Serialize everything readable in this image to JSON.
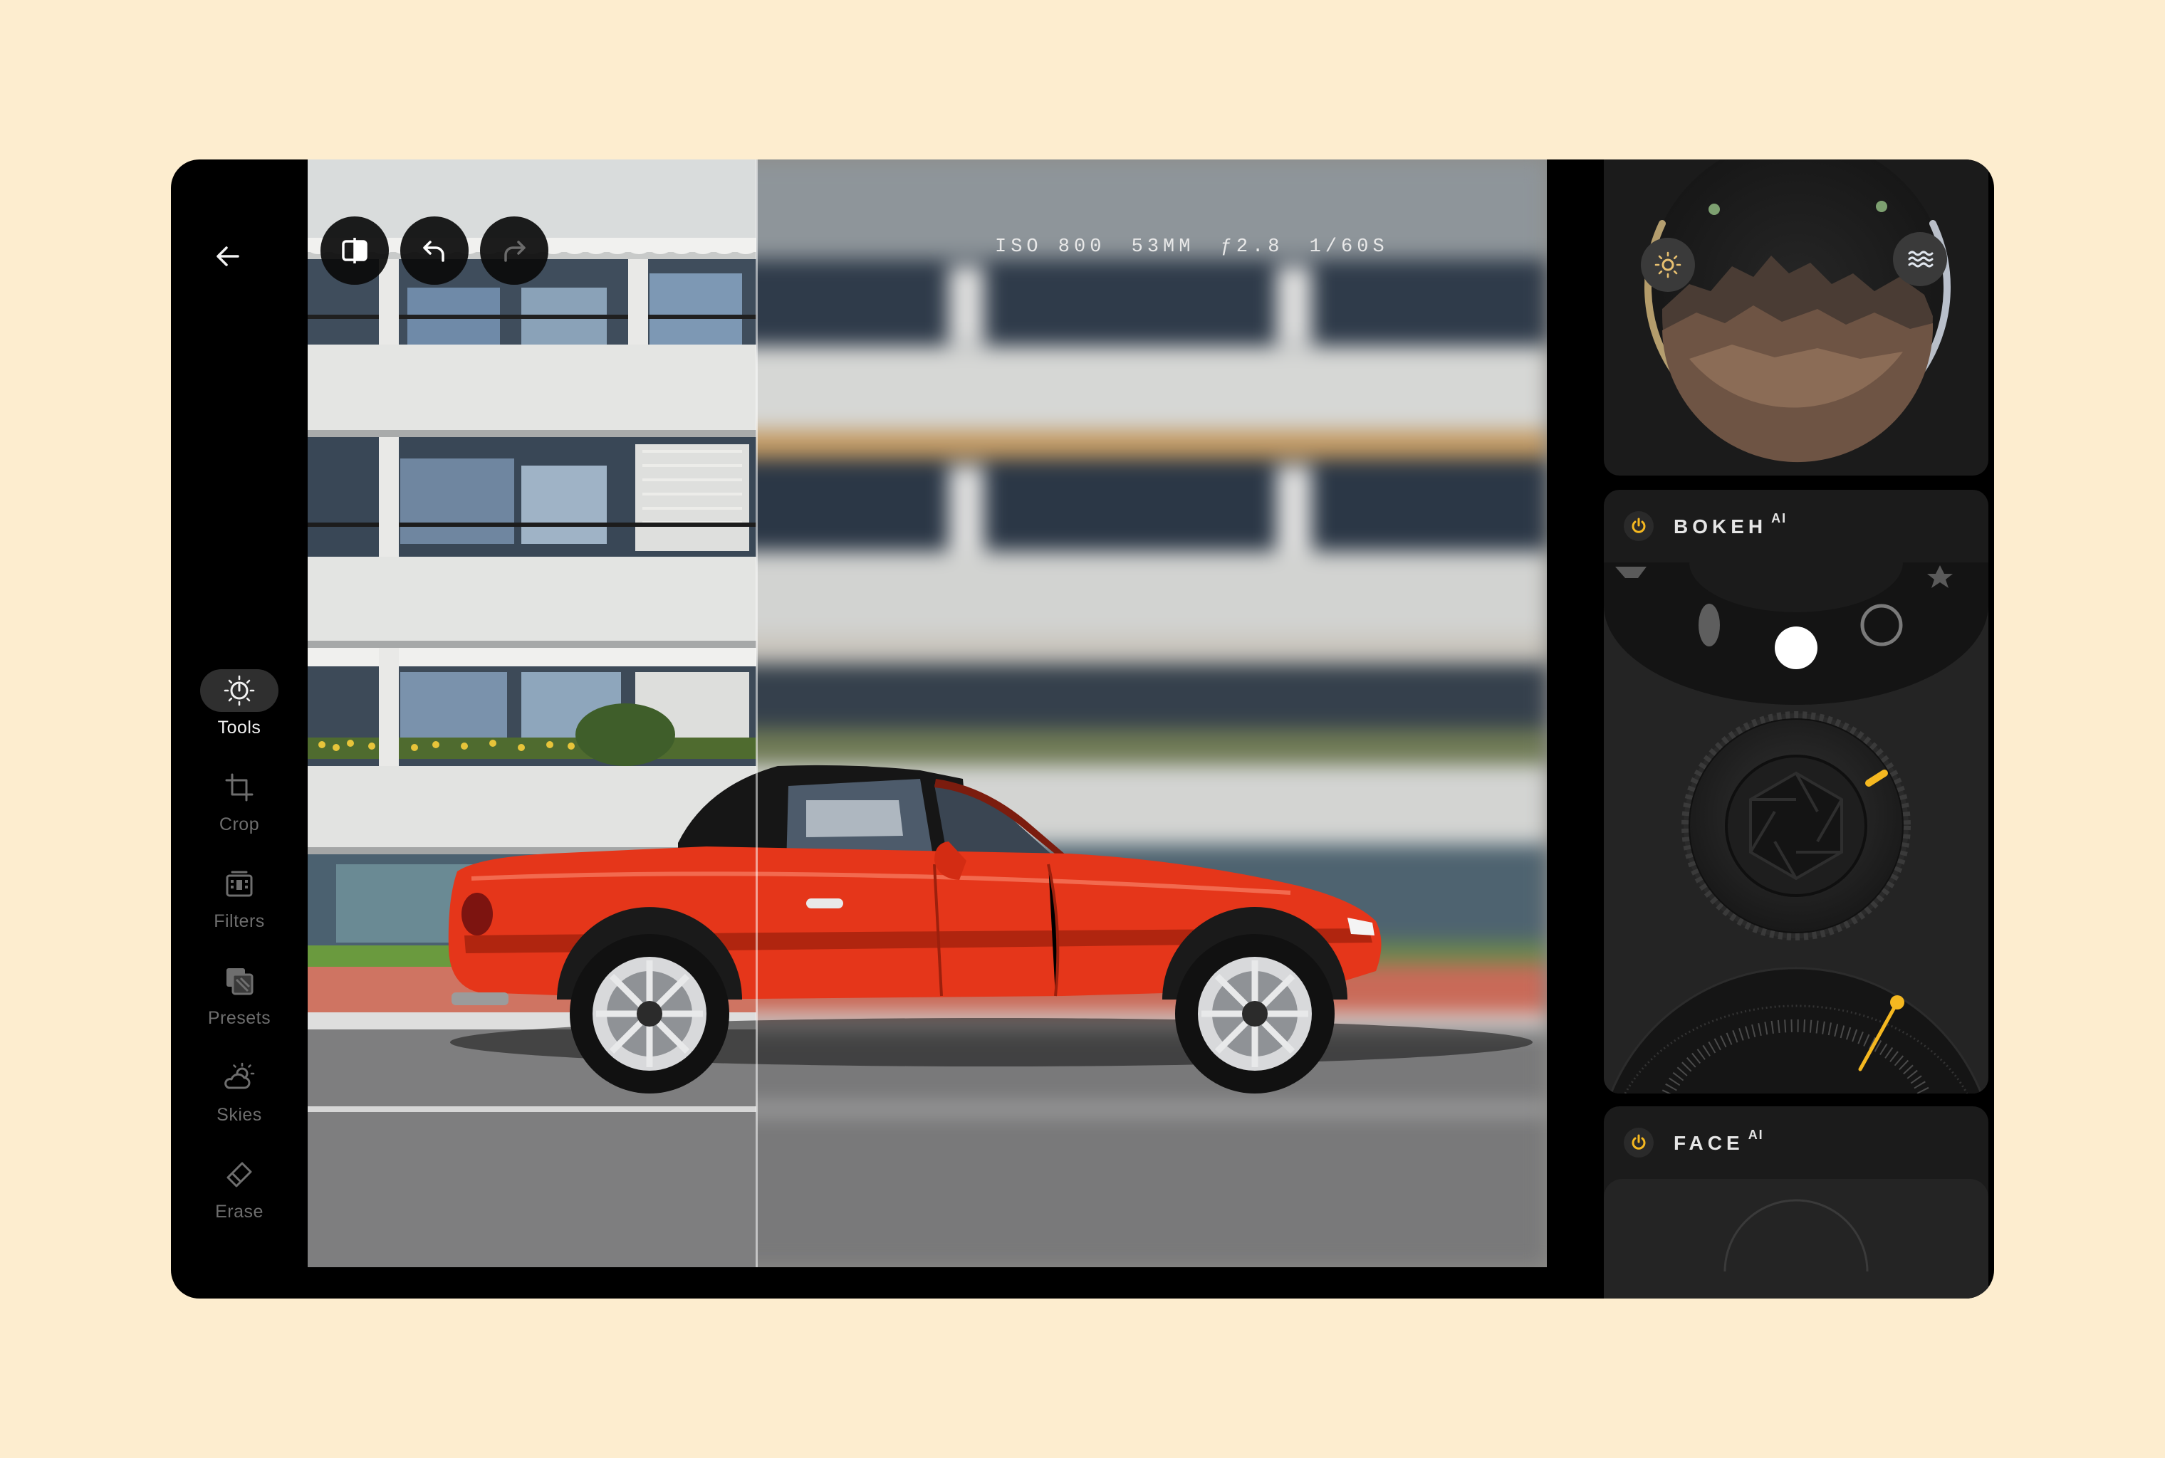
{
  "nav": {
    "back_icon": "arrow-left-icon",
    "items": [
      {
        "label": "Tools",
        "icon": "tools-dial-icon",
        "active": true
      },
      {
        "label": "Crop",
        "icon": "crop-icon",
        "active": false
      },
      {
        "label": "Filters",
        "icon": "filters-icon",
        "active": false
      },
      {
        "label": "Presets",
        "icon": "presets-icon",
        "active": false
      },
      {
        "label": "Skies",
        "icon": "sun-cloud-icon",
        "active": false
      },
      {
        "label": "Erase",
        "icon": "eraser-icon",
        "active": false
      }
    ]
  },
  "toolbar": {
    "compare_icon": "compare-split-icon",
    "undo_icon": "undo-icon",
    "redo_icon": "redo-icon",
    "more_icon": "more-vertical-icon",
    "share_icon": "share-icon"
  },
  "exif": {
    "iso": "ISO 800",
    "focal": "53MM",
    "aperture": "ƒ2.8",
    "shutter": "1/60S"
  },
  "panels": {
    "light": {
      "left_icon": "sun-icon",
      "right_icon": "waves-icon"
    },
    "bokeh": {
      "title": "BOKEH",
      "badge": "AI",
      "enabled": true
    },
    "face": {
      "title": "FACE",
      "badge": "AI",
      "enabled": true
    }
  },
  "colors": {
    "accent": "#f5b820",
    "device_bg": "#000000",
    "page_bg": "#fdedcf",
    "card_bg": "#1b1b1b",
    "car_red": "#e5361a"
  }
}
